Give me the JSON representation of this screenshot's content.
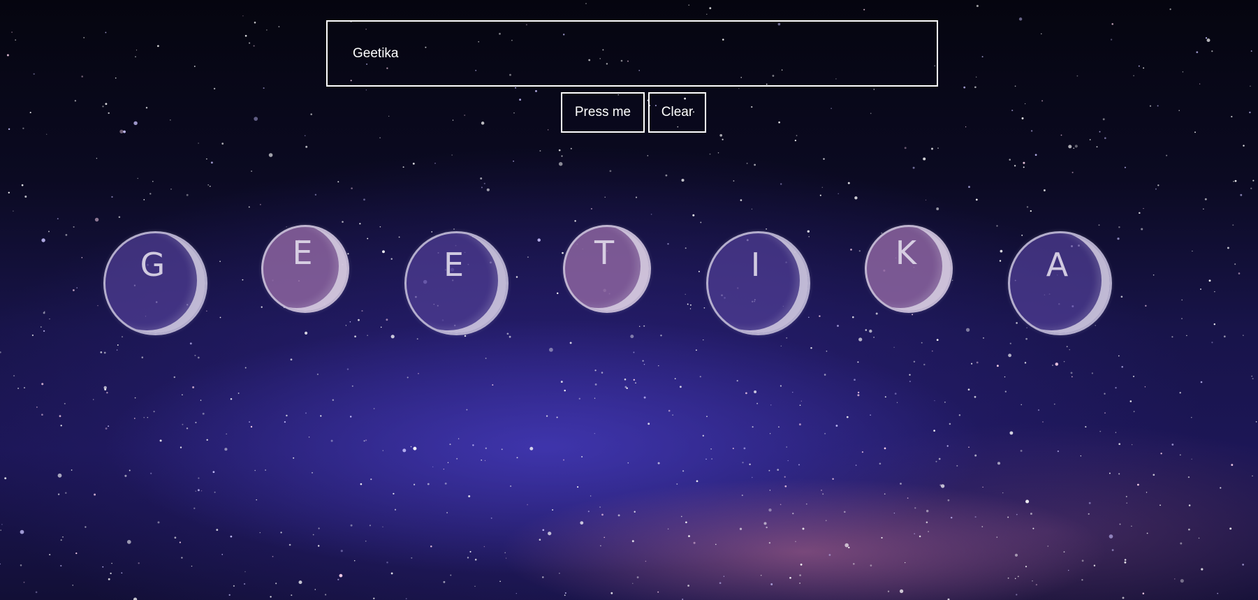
{
  "input": {
    "value": "Geetika"
  },
  "buttons": {
    "press_label": "Press me",
    "clear_label": "Clear"
  },
  "bubbles": [
    "G",
    "E",
    "E",
    "T",
    "I",
    "K",
    "A"
  ],
  "colors": {
    "border": "#ffffff",
    "bubble_large": "#503e96",
    "bubble_small": "#8c64a0",
    "sky_top": "#05050f",
    "galaxy": "#1c1656"
  }
}
